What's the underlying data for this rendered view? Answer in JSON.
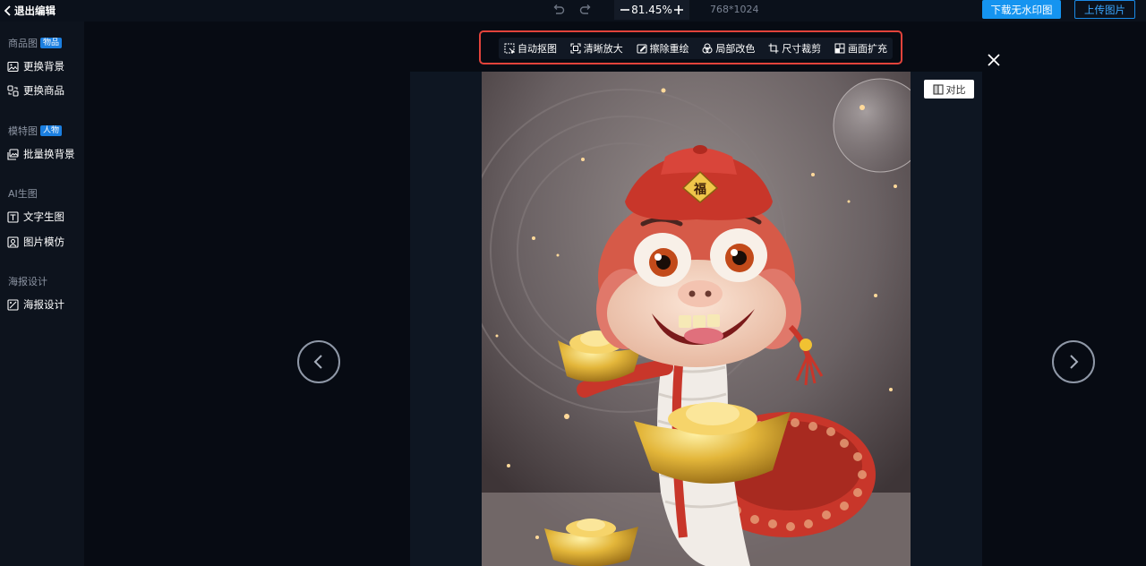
{
  "header": {
    "exit_label": "退出编辑",
    "zoom_value": "81.45%",
    "image_dims": "768*1024",
    "download_label": "下载无水印图",
    "upload_label": "上传图片"
  },
  "sidebar": {
    "sections": [
      {
        "title": "商品图",
        "badge": "物品",
        "items": [
          "更换背景",
          "更换商品"
        ]
      },
      {
        "title": "模特图",
        "badge": "人物",
        "items": [
          "批量换背景"
        ]
      },
      {
        "title": "AI生图",
        "badge": "",
        "items": [
          "文字生图",
          "图片模仿"
        ]
      },
      {
        "title": "海报设计",
        "badge": "",
        "items": [
          "海报设计"
        ]
      }
    ]
  },
  "toolbar": {
    "tools": [
      "自动抠图",
      "清晰放大",
      "擦除重绘",
      "局部改色",
      "尺寸裁剪",
      "画面扩充"
    ]
  },
  "canvas": {
    "compare_label": "对比",
    "photo_subject": "cartoon red snake with gold ingots",
    "hat_text": "福"
  },
  "colors": {
    "accent": "#1594f0",
    "highlight_outline": "#e2433b",
    "background": "#070b13",
    "sidebar_bg": "#0d131d"
  }
}
